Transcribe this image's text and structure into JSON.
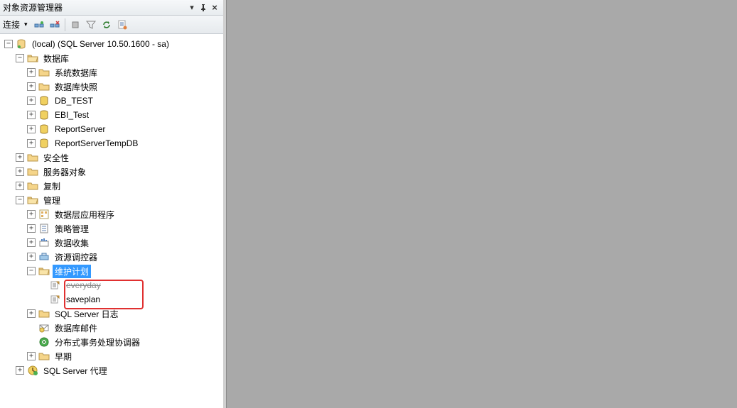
{
  "panel": {
    "title": "对象资源管理器"
  },
  "toolbar": {
    "connect_label": "连接"
  },
  "tree": {
    "server": {
      "label": "(local) (SQL Server 10.50.1600 - sa)",
      "databases": {
        "label": "数据库",
        "sys_db": "系统数据库",
        "snapshot": "数据库快照",
        "db_test": "DB_TEST",
        "ebi_test": "EBI_Test",
        "report_server": "ReportServer",
        "report_server_temp": "ReportServerTempDB"
      },
      "security": "安全性",
      "server_objects": "服务器对象",
      "replication": "复制",
      "management": {
        "label": "管理",
        "data_tier": "数据层应用程序",
        "policy": "策略管理",
        "data_collection": "数据收集",
        "resource_gov": "资源调控器",
        "maint_plans": {
          "label": "维护计划",
          "everyday": "everyday",
          "saveplan": "saveplan"
        },
        "sql_logs": "SQL Server 日志",
        "db_mail": "数据库邮件",
        "dtc": "分布式事务处理协调器",
        "legacy": "早期"
      },
      "agent": "SQL Server 代理"
    }
  }
}
